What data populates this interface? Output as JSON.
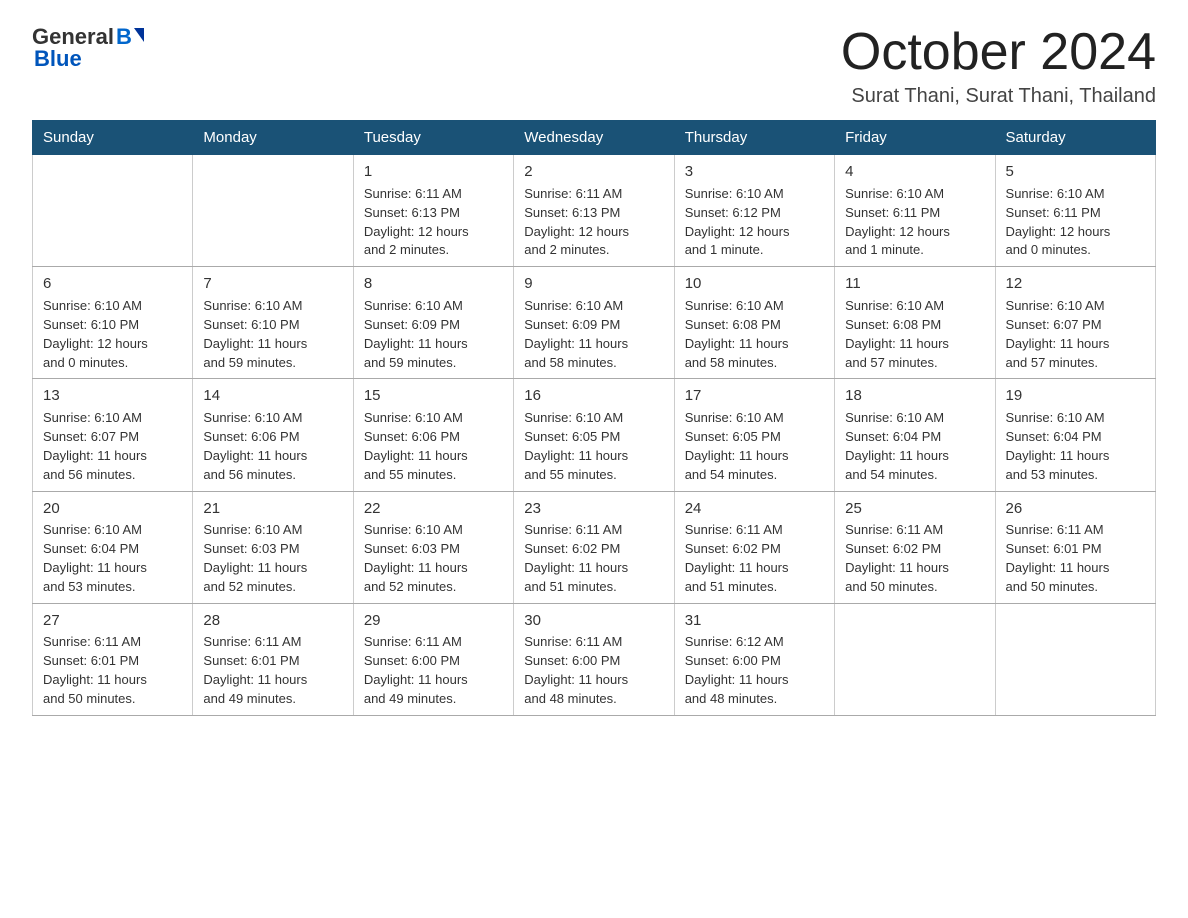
{
  "logo": {
    "general": "General",
    "blue": "Blue"
  },
  "header": {
    "month": "October 2024",
    "location": "Surat Thani, Surat Thani, Thailand"
  },
  "days_of_week": [
    "Sunday",
    "Monday",
    "Tuesday",
    "Wednesday",
    "Thursday",
    "Friday",
    "Saturday"
  ],
  "weeks": [
    [
      {
        "day": "",
        "info": ""
      },
      {
        "day": "",
        "info": ""
      },
      {
        "day": "1",
        "info": "Sunrise: 6:11 AM\nSunset: 6:13 PM\nDaylight: 12 hours\nand 2 minutes."
      },
      {
        "day": "2",
        "info": "Sunrise: 6:11 AM\nSunset: 6:13 PM\nDaylight: 12 hours\nand 2 minutes."
      },
      {
        "day": "3",
        "info": "Sunrise: 6:10 AM\nSunset: 6:12 PM\nDaylight: 12 hours\nand 1 minute."
      },
      {
        "day": "4",
        "info": "Sunrise: 6:10 AM\nSunset: 6:11 PM\nDaylight: 12 hours\nand 1 minute."
      },
      {
        "day": "5",
        "info": "Sunrise: 6:10 AM\nSunset: 6:11 PM\nDaylight: 12 hours\nand 0 minutes."
      }
    ],
    [
      {
        "day": "6",
        "info": "Sunrise: 6:10 AM\nSunset: 6:10 PM\nDaylight: 12 hours\nand 0 minutes."
      },
      {
        "day": "7",
        "info": "Sunrise: 6:10 AM\nSunset: 6:10 PM\nDaylight: 11 hours\nand 59 minutes."
      },
      {
        "day": "8",
        "info": "Sunrise: 6:10 AM\nSunset: 6:09 PM\nDaylight: 11 hours\nand 59 minutes."
      },
      {
        "day": "9",
        "info": "Sunrise: 6:10 AM\nSunset: 6:09 PM\nDaylight: 11 hours\nand 58 minutes."
      },
      {
        "day": "10",
        "info": "Sunrise: 6:10 AM\nSunset: 6:08 PM\nDaylight: 11 hours\nand 58 minutes."
      },
      {
        "day": "11",
        "info": "Sunrise: 6:10 AM\nSunset: 6:08 PM\nDaylight: 11 hours\nand 57 minutes."
      },
      {
        "day": "12",
        "info": "Sunrise: 6:10 AM\nSunset: 6:07 PM\nDaylight: 11 hours\nand 57 minutes."
      }
    ],
    [
      {
        "day": "13",
        "info": "Sunrise: 6:10 AM\nSunset: 6:07 PM\nDaylight: 11 hours\nand 56 minutes."
      },
      {
        "day": "14",
        "info": "Sunrise: 6:10 AM\nSunset: 6:06 PM\nDaylight: 11 hours\nand 56 minutes."
      },
      {
        "day": "15",
        "info": "Sunrise: 6:10 AM\nSunset: 6:06 PM\nDaylight: 11 hours\nand 55 minutes."
      },
      {
        "day": "16",
        "info": "Sunrise: 6:10 AM\nSunset: 6:05 PM\nDaylight: 11 hours\nand 55 minutes."
      },
      {
        "day": "17",
        "info": "Sunrise: 6:10 AM\nSunset: 6:05 PM\nDaylight: 11 hours\nand 54 minutes."
      },
      {
        "day": "18",
        "info": "Sunrise: 6:10 AM\nSunset: 6:04 PM\nDaylight: 11 hours\nand 54 minutes."
      },
      {
        "day": "19",
        "info": "Sunrise: 6:10 AM\nSunset: 6:04 PM\nDaylight: 11 hours\nand 53 minutes."
      }
    ],
    [
      {
        "day": "20",
        "info": "Sunrise: 6:10 AM\nSunset: 6:04 PM\nDaylight: 11 hours\nand 53 minutes."
      },
      {
        "day": "21",
        "info": "Sunrise: 6:10 AM\nSunset: 6:03 PM\nDaylight: 11 hours\nand 52 minutes."
      },
      {
        "day": "22",
        "info": "Sunrise: 6:10 AM\nSunset: 6:03 PM\nDaylight: 11 hours\nand 52 minutes."
      },
      {
        "day": "23",
        "info": "Sunrise: 6:11 AM\nSunset: 6:02 PM\nDaylight: 11 hours\nand 51 minutes."
      },
      {
        "day": "24",
        "info": "Sunrise: 6:11 AM\nSunset: 6:02 PM\nDaylight: 11 hours\nand 51 minutes."
      },
      {
        "day": "25",
        "info": "Sunrise: 6:11 AM\nSunset: 6:02 PM\nDaylight: 11 hours\nand 50 minutes."
      },
      {
        "day": "26",
        "info": "Sunrise: 6:11 AM\nSunset: 6:01 PM\nDaylight: 11 hours\nand 50 minutes."
      }
    ],
    [
      {
        "day": "27",
        "info": "Sunrise: 6:11 AM\nSunset: 6:01 PM\nDaylight: 11 hours\nand 50 minutes."
      },
      {
        "day": "28",
        "info": "Sunrise: 6:11 AM\nSunset: 6:01 PM\nDaylight: 11 hours\nand 49 minutes."
      },
      {
        "day": "29",
        "info": "Sunrise: 6:11 AM\nSunset: 6:00 PM\nDaylight: 11 hours\nand 49 minutes."
      },
      {
        "day": "30",
        "info": "Sunrise: 6:11 AM\nSunset: 6:00 PM\nDaylight: 11 hours\nand 48 minutes."
      },
      {
        "day": "31",
        "info": "Sunrise: 6:12 AM\nSunset: 6:00 PM\nDaylight: 11 hours\nand 48 minutes."
      },
      {
        "day": "",
        "info": ""
      },
      {
        "day": "",
        "info": ""
      }
    ]
  ]
}
